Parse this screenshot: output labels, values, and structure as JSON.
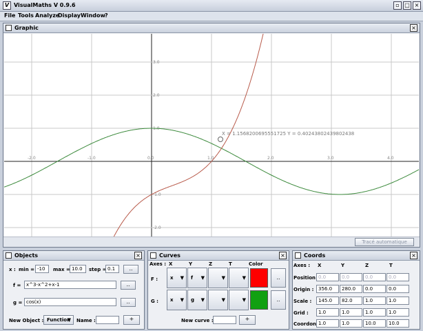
{
  "app": {
    "title": "VisualMaths V 0.9.6",
    "logo_letter": "V"
  },
  "window_controls": [
    "minimize-icon",
    "maximize-icon",
    "close-icon"
  ],
  "menu": [
    "File",
    "Tools",
    "Analyze",
    "Display",
    "Window",
    "?"
  ],
  "graphic": {
    "title": "Graphic",
    "intersection_label": "X = 1.1568200695551725 Y = 0.40243802439802438",
    "auto_trace_button": "Tracé automatique",
    "x_ticks": [
      "-2.0",
      "-1.0",
      "0.0",
      "1.0",
      "2.0",
      "3.0",
      "4.0"
    ],
    "y_ticks": [
      "3.0",
      "2.0",
      "1.0",
      "-1.0",
      "-2.0"
    ],
    "colors": {
      "curve_f": "#b85a4a",
      "curve_g": "#3c8a3c",
      "grid": "#c8c8c8",
      "axes": "#222222"
    }
  },
  "objects": {
    "title": "Objects",
    "x_label": "x :",
    "min_label": "min =",
    "min_value": "-10",
    "max_label": "max =",
    "max_value": "10.0",
    "step_label": "step =",
    "step_value": "0.1",
    "f_label": "f =",
    "f_value": "x^3-x^2+x-1",
    "g_label": "g =",
    "g_value": "cos(x)",
    "button_label": "..",
    "new_object_label": "New Object :",
    "new_object_type": "Function",
    "name_label": "Name :",
    "add_button": "+"
  },
  "curves": {
    "title": "Curves",
    "headers": [
      "Axes :",
      "X",
      "Y",
      "Z",
      "T",
      "Color"
    ],
    "rows": [
      {
        "name": "F :",
        "x": "x",
        "y": "f",
        "z": "",
        "t": "",
        "color": "#ff0000"
      },
      {
        "name": "G :",
        "x": "x",
        "y": "g",
        "z": "",
        "t": "",
        "color": "#11a011"
      }
    ],
    "button_label": "..",
    "new_curve_label": "New curve :",
    "add_button": "+"
  },
  "coords": {
    "title": "Coords",
    "headers": [
      "Axes :",
      "X",
      "Y",
      "Z",
      "T"
    ],
    "rows": [
      {
        "label": "Position :",
        "values": [
          "0.0",
          "0.0",
          "0.0",
          "0.0"
        ],
        "disabled": true
      },
      {
        "label": "Origin :",
        "values": [
          "356.0",
          "280.0",
          "0.0",
          "0.0"
        ],
        "disabled": false
      },
      {
        "label": "Scale :",
        "values": [
          "145.0",
          "82.0",
          "1.0",
          "1.0"
        ],
        "disabled": false
      },
      {
        "label": "Grid :",
        "values": [
          "1.0",
          "1.0",
          "1.0",
          "1.0"
        ],
        "disabled": false
      },
      {
        "label": "Coordon...",
        "values": [
          "1.0",
          "1.0",
          "10.0",
          "10.0"
        ],
        "disabled": false
      }
    ]
  }
}
